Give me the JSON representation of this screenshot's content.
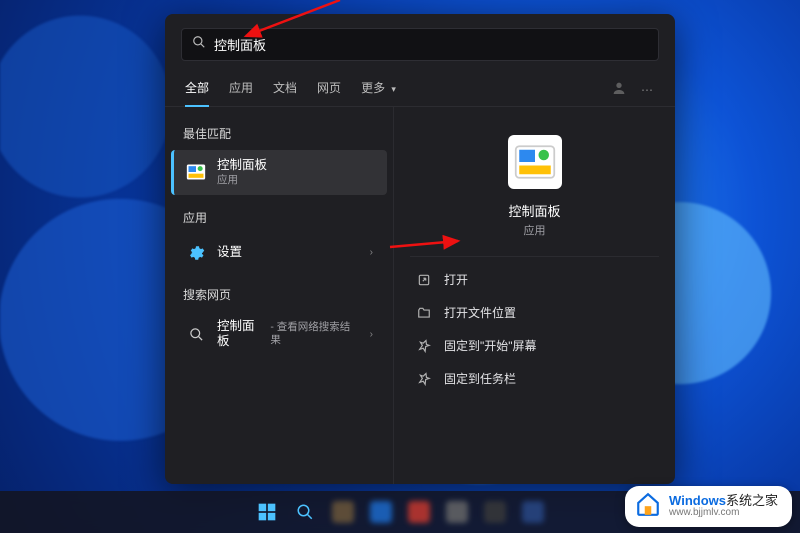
{
  "search": {
    "value": "控制面板"
  },
  "tabs": {
    "items": [
      "全部",
      "应用",
      "文档",
      "网页",
      "更多"
    ],
    "active_index": 0
  },
  "left": {
    "best_match_header": "最佳匹配",
    "best_match": {
      "title": "控制面板",
      "subtitle": "应用"
    },
    "apps_header": "应用",
    "apps": [
      {
        "title": "设置"
      }
    ],
    "web_header": "搜索网页",
    "web": [
      {
        "title": "控制面板",
        "subtitle": "查看网络搜索结果"
      }
    ]
  },
  "right": {
    "app_title": "控制面板",
    "app_subtitle": "应用",
    "actions": [
      {
        "key": "open",
        "label": "打开"
      },
      {
        "key": "open_file_location",
        "label": "打开文件位置"
      },
      {
        "key": "pin_to_start",
        "label": "固定到\"开始\"屏幕"
      },
      {
        "key": "pin_to_taskbar",
        "label": "固定到任务栏"
      }
    ]
  },
  "watermark": {
    "brand_prefix": "Windows",
    "brand_suffix": "系统之家",
    "url": "www.bjjmlv.com"
  }
}
